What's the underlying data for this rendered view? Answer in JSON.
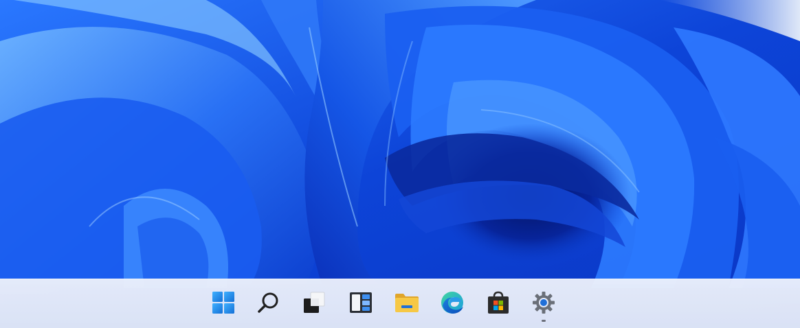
{
  "desktop": {
    "wallpaper": "windows-11-bloom",
    "colors": {
      "base": "#0a2fb8",
      "mid": "#1a63f0",
      "light": "#5aa6ff",
      "shadow": "#061a6e"
    }
  },
  "taskbar": {
    "background": "#e4e9f7",
    "items": [
      {
        "id": "start",
        "icon": "windows-logo-icon",
        "color": "#1f8be6"
      },
      {
        "id": "search",
        "icon": "search-icon",
        "color": "#202020"
      },
      {
        "id": "task-view",
        "icon": "task-view-icon",
        "color": "#202020"
      },
      {
        "id": "widgets",
        "icon": "widgets-icon",
        "color": "#1f6fd1"
      },
      {
        "id": "file-explorer",
        "icon": "folder-icon",
        "color": "#f5c343"
      },
      {
        "id": "edge",
        "icon": "edge-icon",
        "color": "#1b7ee0"
      },
      {
        "id": "store",
        "icon": "store-icon",
        "color": "#2b2b2b"
      },
      {
        "id": "settings",
        "icon": "gear-icon",
        "color": "#6a6f78",
        "running": true
      }
    ]
  }
}
